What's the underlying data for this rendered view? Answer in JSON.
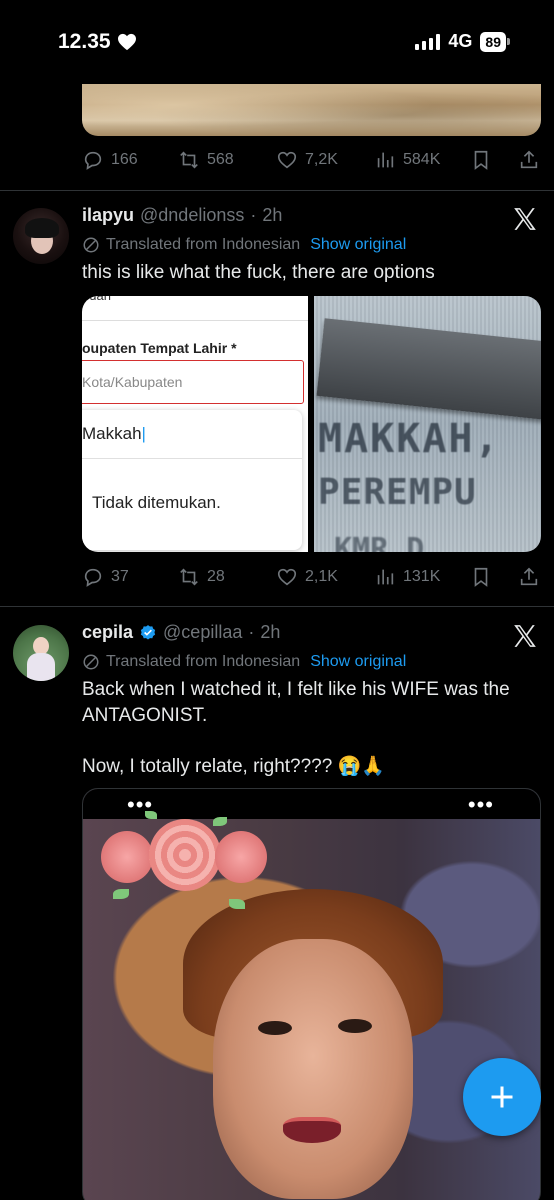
{
  "status_bar": {
    "time": "12.35",
    "network": "4G",
    "battery": "89"
  },
  "feed": {
    "previous_tweet": {
      "replies": "166",
      "reposts": "568",
      "likes": "7,2K",
      "views": "584K"
    },
    "tweets": [
      {
        "name": "ilapyu",
        "handle": "@dndelionss",
        "time": "2h",
        "verified": false,
        "translated_label": "Translated from Indonesian",
        "show_original": "Show original",
        "text": "this is like what the fuck, there are options",
        "media": {
          "form_cut_text": "puan",
          "form_label": "oupaten Tempat Lahir *",
          "form_placeholder": "Kota/Kabupaten",
          "dropdown_value": "Makkah",
          "dropdown_empty": "Tidak ditemukan.",
          "id_text_1": "MAKKAH,",
          "id_text_2": "PEREMPU",
          "id_text_3": "KMR D"
        },
        "replies": "37",
        "reposts": "28",
        "likes": "2,1K",
        "views": "131K"
      },
      {
        "name": "cepila",
        "handle": "@cepillaa",
        "time": "2h",
        "verified": true,
        "translated_label": "Translated from Indonesian",
        "show_original": "Show original",
        "text_line1": "Back when I watched it, I felt like his WIFE was the ANTAGONIST.",
        "text_line2": "Now, I totally relate, right???? 😭🙏",
        "media": {
          "dots_left": "•••",
          "dots_right": "•••"
        }
      }
    ]
  },
  "colors": {
    "background": "#000000",
    "text": "#e7e9ea",
    "muted": "#71767b",
    "accent": "#1d9bf0",
    "divider": "#2f3336"
  },
  "icons": {
    "reply": "speech-bubble",
    "repost": "arrows-loop",
    "like": "heart-outline",
    "views": "bar-chart",
    "bookmark": "bookmark",
    "share": "upload-arrow",
    "compose": "plus"
  }
}
